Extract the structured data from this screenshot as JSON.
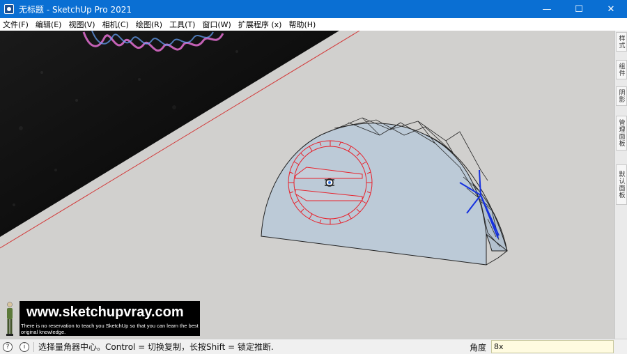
{
  "window": {
    "title": "无标题 - SketchUp Pro 2021",
    "controls": {
      "minimize": "—",
      "maximize": "☐",
      "close": "✕"
    }
  },
  "menu": {
    "items": [
      {
        "label": "文件(F)"
      },
      {
        "label": "编辑(E)"
      },
      {
        "label": "视图(V)"
      },
      {
        "label": "相机(C)"
      },
      {
        "label": "绘图(R)"
      },
      {
        "label": "工具(T)"
      },
      {
        "label": "窗口(W)"
      },
      {
        "label": "扩展程序 (x)"
      },
      {
        "label": "帮助(H)"
      }
    ]
  },
  "tray": {
    "tabs": [
      {
        "label": "样式"
      },
      {
        "label": "组件"
      },
      {
        "label": "阴影"
      },
      {
        "label": "管理面板"
      },
      {
        "label": "默认面板"
      }
    ]
  },
  "watermark": {
    "url": "www.sketchupvray.com",
    "tagline": "There is no reservation to teach you SketchUp so that you can learn the best original knowledge."
  },
  "status": {
    "icons": {
      "help": "?",
      "info": "i"
    },
    "message": "选择量角器中心。Control = 切换复制，长按Shift = 锁定推断.",
    "measure_label": "角度",
    "measure_value": "8x"
  },
  "icons": {
    "app": "sketchup-logo-icon",
    "protractor_cursor": "protractor-cursor-icon",
    "help": "help-icon",
    "info": "info-icon"
  },
  "colors": {
    "titlebar": "#0a6fd3",
    "viewport_background": "#d1d0ce",
    "model_face": "#bccad7",
    "protractor": "#e8202a",
    "selected_edges": "#1530e0",
    "measure_box": "#fffbe0"
  }
}
